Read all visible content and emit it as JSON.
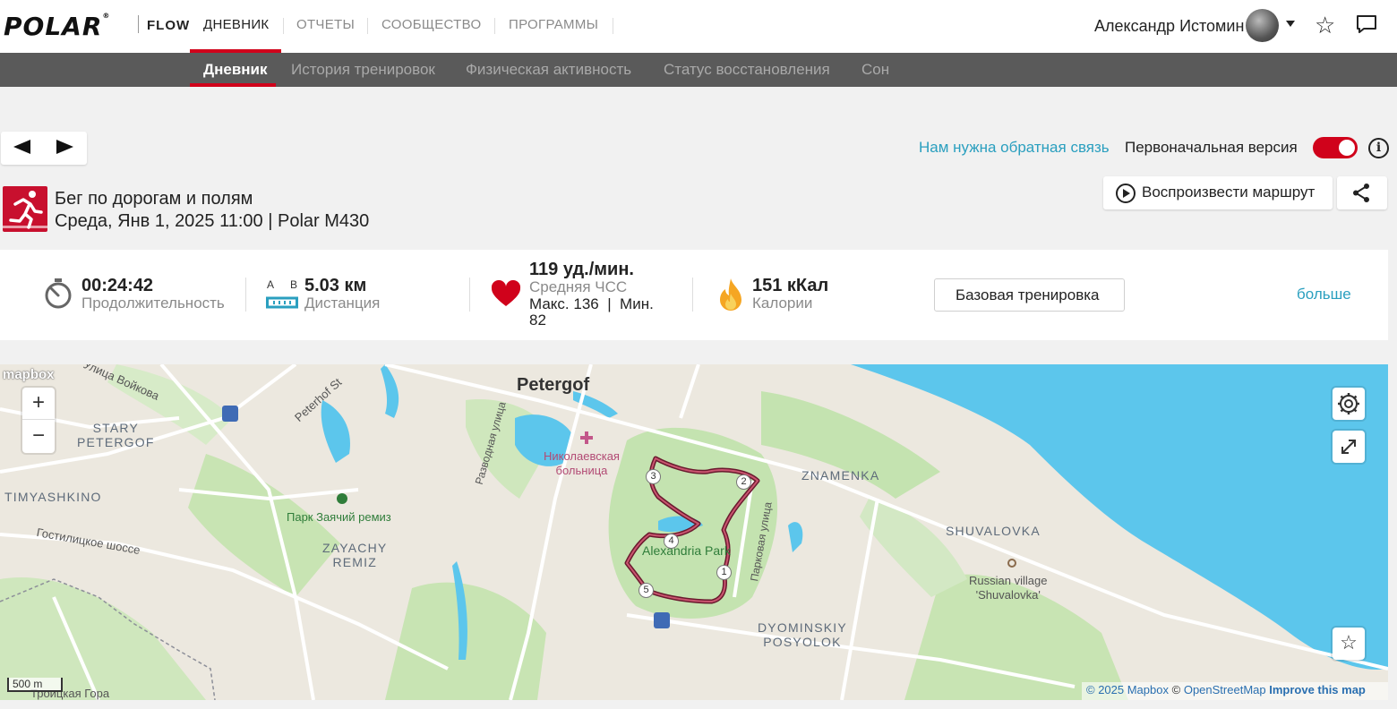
{
  "header": {
    "logo": "POLAR",
    "logo_mark": "®",
    "product": "FLOW",
    "nav": [
      "ДНЕВНИК",
      "ОТЧЕТЫ",
      "СООБЩЕСТВО",
      "ПРОГРАММЫ"
    ],
    "active_nav": "ДНЕВНИК",
    "user_name": "Александр Истомин",
    "icons": [
      "avatar",
      "chevron-down-icon",
      "star-icon",
      "message-icon"
    ]
  },
  "subnav": {
    "items": [
      "Дневник",
      "История тренировок",
      "Физическая активность",
      "Статус восстановления",
      "Сон"
    ],
    "active": "Дневник"
  },
  "toolbar": {
    "feedback_link": "Нам нужна обратная связь",
    "original_version_label": "Первоначальная версия",
    "original_version_on": true,
    "accent_color": "#d0021b",
    "link_color": "#2a9fbf"
  },
  "activity": {
    "sport": "Бег по дорогам и полям",
    "subtitle": "Среда, Янв 1, 2025 11:00 | Polar M430",
    "replay_label": "Воспроизвести маршрут"
  },
  "stats": {
    "duration_value": "00:24:42",
    "duration_label": "Продолжительность",
    "distance_ab_a": "A",
    "distance_ab_b": "B",
    "distance_value": "5.03 км",
    "distance_label": "Дистанция",
    "hr_value": "119 уд./мин.",
    "hr_label": "Средняя ЧСС",
    "hr_line1": "Макс. 136  |  Мин.",
    "hr_line2": "82",
    "calories_value": "151 кКал",
    "calories_label": "Калории",
    "training_benefit": "Базовая тренировка",
    "more_link": "больше"
  },
  "map": {
    "labels": {
      "petergof": "Petergof",
      "ulitsa_voykova": "Улица Войкова",
      "peterhof_st": "Peterhof St",
      "stary_petergof": "STARY\nPETERGOF",
      "timyashkino": "TIMYASHKINO",
      "gostilitskoe": "Гостилицкое шоссе",
      "park_zayachiy": "Парк Заячий ремиз",
      "zayachy_remiz": "ZAYACHY\nREMIZ",
      "razvodnaya": "Разводная улица",
      "hospital": "Николаевская\nбольница",
      "alexandria_park": "Alexandria Park",
      "parkovaya": "Парковая улица",
      "znamenka": "ZNAMENKA",
      "shuvalovka": "SHUVALOVKA",
      "russian_village": "Russian village\n'Shuvalovka'",
      "dyominskiy": "DYOMINSKIY\nPOSYOLOK",
      "troitskaya": "Троицкая Гора"
    },
    "waypoints": [
      "1",
      "2",
      "3",
      "4",
      "5"
    ],
    "route_color": "#9b2443",
    "water_color": "#5cc6ec",
    "park_color": "#c4e3b0",
    "zoom_in": "+",
    "zoom_out": "−",
    "brand": "mapbox",
    "scale": "500 m",
    "attribution_1": "© 2025 Mapbox",
    "attribution_2": "©",
    "attribution_3": "OpenStreetMap",
    "attribution_4": "Improve this map"
  }
}
